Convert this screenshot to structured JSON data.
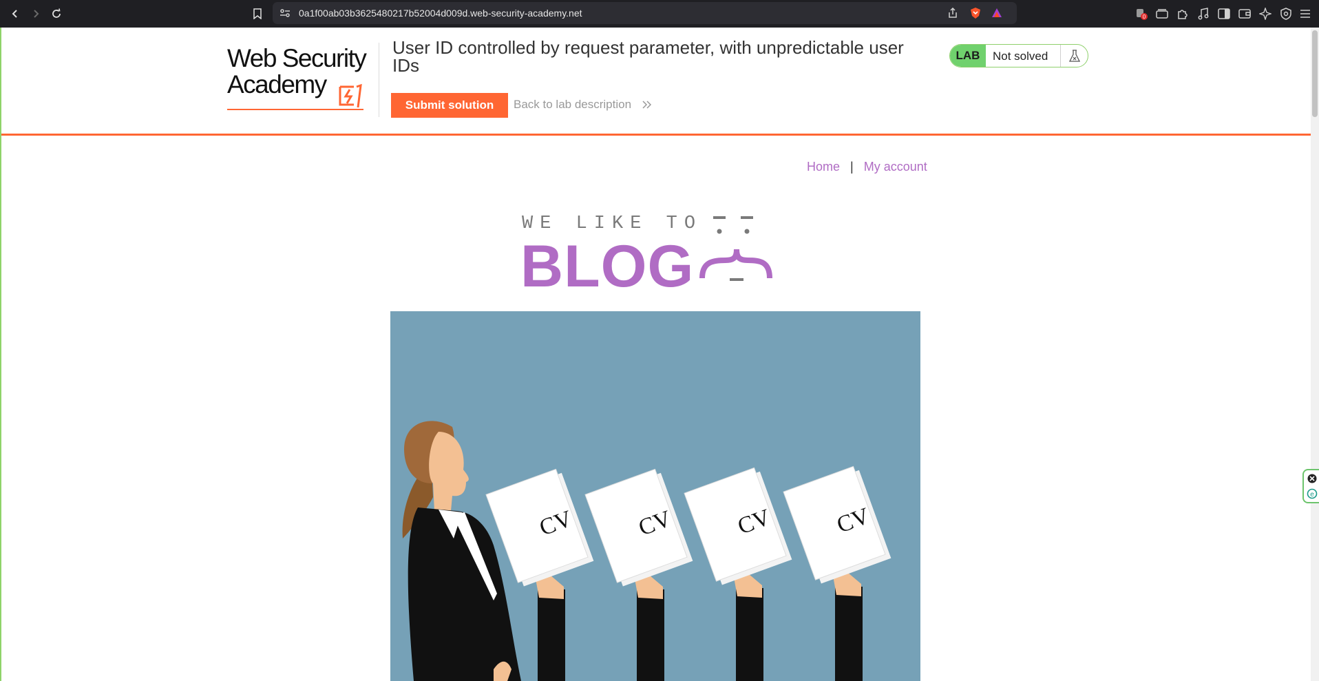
{
  "browser": {
    "url": "0a1f00ab03b3625480217b52004d009d.web-security-academy.net",
    "shields_badge": "0"
  },
  "lab": {
    "logo_line1": "Web Security",
    "logo_line2": "Academy",
    "title": "User ID controlled by request parameter, with unpredictable user IDs",
    "submit_label": "Submit solution",
    "back_label": "Back to lab description",
    "status_pill": "LAB",
    "status_text": "Not solved"
  },
  "nav": {
    "home": "Home",
    "separator": "|",
    "account": "My account"
  },
  "banner": {
    "tagline": "WE LIKE TO",
    "word": "BLOG"
  },
  "hero": {
    "cv_labels": [
      "CV",
      "CV",
      "CV",
      "CV"
    ]
  },
  "colors": {
    "accent_orange": "#ff6633",
    "link_purple": "#b06cc4",
    "lab_green": "#70d16d",
    "hero_bg": "#6f9bb1"
  }
}
